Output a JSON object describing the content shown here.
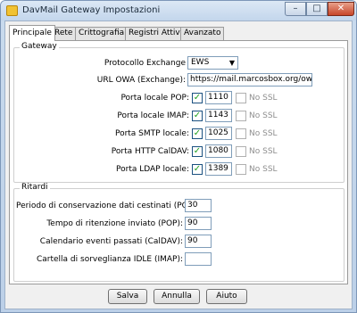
{
  "window": {
    "title": "DavMail Gateway Impostazioni",
    "minimize": "–",
    "maximize": "□",
    "close": "✕"
  },
  "tabs": [
    {
      "label": "Principale",
      "active": true
    },
    {
      "label": "Rete",
      "active": false
    },
    {
      "label": "Crittografia",
      "active": false
    },
    {
      "label": "Registri Attivita",
      "active": false
    },
    {
      "label": "Avanzato",
      "active": false
    }
  ],
  "gateway": {
    "title": "Gateway",
    "protocol_label": "Protocollo Exchange",
    "protocol_value": "EWS",
    "owa_label": "URL OWA (Exchange):",
    "owa_value": "https://mail.marcosbox.org/owa/",
    "no_ssl_label": "No SSL",
    "ports": [
      {
        "label": "Porta locale POP:",
        "value": "1110",
        "enabled": true,
        "no_ssl": false
      },
      {
        "label": "Porta locale IMAP:",
        "value": "1143",
        "enabled": true,
        "no_ssl": false
      },
      {
        "label": "Porta SMTP locale:",
        "value": "1025",
        "enabled": true,
        "no_ssl": false
      },
      {
        "label": "Porta HTTP CalDAV:",
        "value": "1080",
        "enabled": true,
        "no_ssl": false
      },
      {
        "label": "Porta LDAP locale:",
        "value": "1389",
        "enabled": true,
        "no_ssl": false
      }
    ]
  },
  "ritardi": {
    "title": "Ritardi",
    "fields": [
      {
        "label": "Periodo di conservazione dati cestinati (POP):",
        "value": "30"
      },
      {
        "label": "Tempo di ritenzione inviato (POP):",
        "value": "90"
      },
      {
        "label": "Calendario eventi passati (CalDAV):",
        "value": "90"
      },
      {
        "label": "Cartella di sorveglianza IDLE (IMAP):",
        "value": ""
      }
    ]
  },
  "buttons": {
    "save": "Salva",
    "cancel": "Annulla",
    "help": "Aiuto"
  },
  "colors": {
    "check": "#21a121",
    "titlebar": "#c3d6ec"
  }
}
